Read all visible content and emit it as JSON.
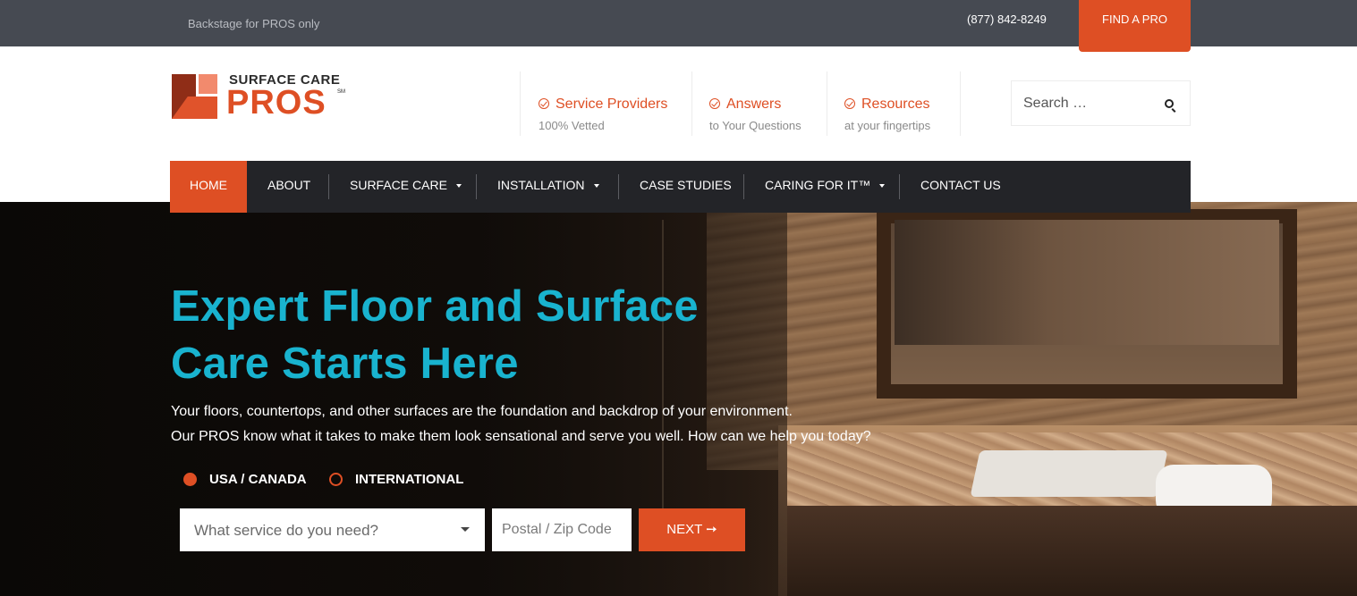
{
  "topbar": {
    "tagline": "Backstage for PROS only",
    "phone": "(877) 842-8249",
    "find_pro": "FIND A PRO"
  },
  "logo": {
    "top": "SURFACE CARE",
    "main": "PROS",
    "sm": "SM"
  },
  "features": [
    {
      "title": "Service Providers",
      "sub": "100% Vetted"
    },
    {
      "title": "Answers",
      "sub": "to Your Questions"
    },
    {
      "title": "Resources",
      "sub": "at your fingertips"
    }
  ],
  "search": {
    "placeholder": "Search …"
  },
  "nav": {
    "items": [
      "HOME",
      "ABOUT",
      "SURFACE CARE",
      "INSTALLATION",
      "CASE STUDIES",
      "CARING FOR IT™",
      "CONTACT US"
    ]
  },
  "hero": {
    "title_line1": "Expert Floor and Surface",
    "title_line2": "Care Starts Here",
    "desc_line1": "Your floors, countertops, and other surfaces are the foundation and backdrop of your environment.",
    "desc_line2": "Our PROS know what it takes to make them look sensational and serve you well. How can we help you today?",
    "radio_usa": "USA / CANADA",
    "radio_intl": "INTERNATIONAL",
    "service_placeholder": "What service do you need?",
    "zip_placeholder": "Postal / Zip Code",
    "next_label": "NEXT ➙"
  },
  "colors": {
    "accent": "#de4f24",
    "teal": "#19b3cf",
    "topbar": "#464a52",
    "nav": "#232428"
  }
}
